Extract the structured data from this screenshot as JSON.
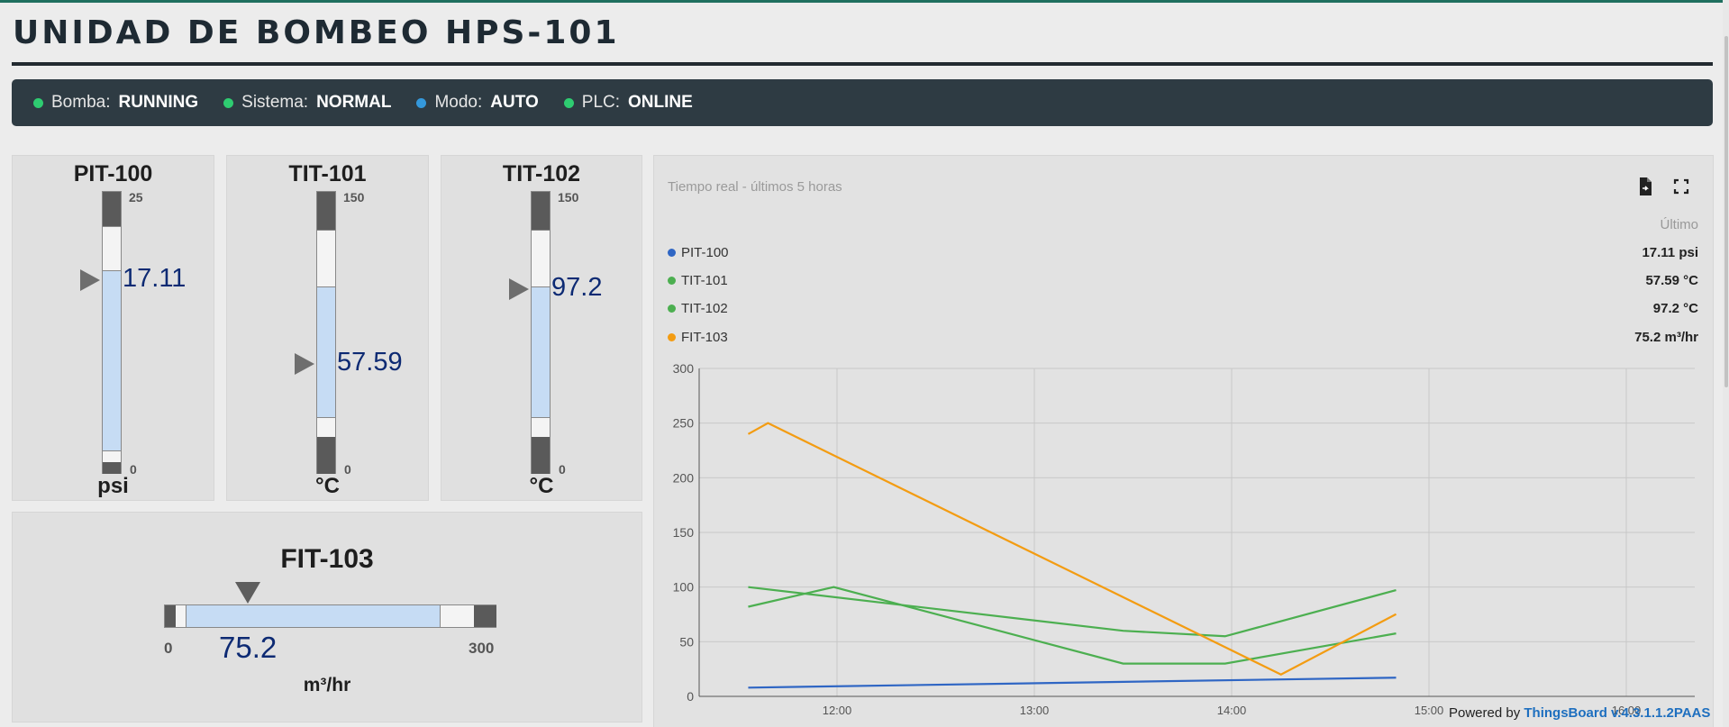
{
  "title": "UNIDAD DE BOMBEO HPS-101",
  "status": [
    {
      "key": "Bomba:",
      "value": "RUNNING",
      "color": "#2ecc71"
    },
    {
      "key": "Sistema:",
      "value": "NORMAL",
      "color": "#2ecc71"
    },
    {
      "key": "Modo:",
      "value": "AUTO",
      "color": "#3498db"
    },
    {
      "key": "PLC:",
      "value": "ONLINE",
      "color": "#2ecc71"
    }
  ],
  "gauges": {
    "pit100": {
      "name": "PIT-100",
      "unit": "psi",
      "value": "17.11",
      "max": "25",
      "min": "0"
    },
    "tit101": {
      "name": "TIT-101",
      "unit": "°C",
      "value": "57.59",
      "max": "150",
      "min": "0"
    },
    "tit102": {
      "name": "TIT-102",
      "unit": "°C",
      "value": "97.2",
      "max": "150",
      "min": "0"
    },
    "fit103": {
      "name": "FIT-103",
      "unit": "m³/hr",
      "value": "75.2",
      "max": "300",
      "min": "0"
    }
  },
  "chart": {
    "subtitle": "Tiempo real - últimos 5 horas",
    "legend_header": "Último",
    "legend": [
      {
        "name": "PIT-100",
        "value": "17.11 psi",
        "color": "#2f66c4"
      },
      {
        "name": "TIT-101",
        "value": "57.59 °C",
        "color": "#4caf50"
      },
      {
        "name": "TIT-102",
        "value": "97.2 °C",
        "color": "#4caf50"
      },
      {
        "name": "FIT-103",
        "value": "75.2 m³/hr",
        "color": "#f39c12"
      }
    ]
  },
  "chart_data": {
    "type": "line",
    "ylim": [
      0,
      300
    ],
    "yticks": [
      "0",
      "50",
      "100",
      "150",
      "200",
      "250",
      "300"
    ],
    "xticks": [
      "12:00",
      "13:00",
      "14:00",
      "15:00",
      "16:00"
    ],
    "grid": true,
    "series": [
      {
        "name": "PIT-100",
        "color": "#2f66c4",
        "x": [
          "11:33",
          "14:50"
        ],
        "y": [
          8,
          17.11
        ]
      },
      {
        "name": "TIT-101",
        "color": "#4caf50",
        "x": [
          "11:33",
          "11:59",
          "13:27",
          "13:58",
          "14:50"
        ],
        "y": [
          82,
          100,
          30,
          30,
          57.59
        ]
      },
      {
        "name": "TIT-102",
        "color": "#4caf50",
        "x": [
          "11:33",
          "13:27",
          "13:58",
          "14:50"
        ],
        "y": [
          100,
          60,
          55,
          97.2
        ]
      },
      {
        "name": "FIT-103",
        "color": "#f39c12",
        "x": [
          "11:33",
          "11:39",
          "14:15",
          "14:50"
        ],
        "y": [
          240,
          250,
          20,
          75.2
        ]
      }
    ]
  },
  "footer": {
    "prefix": "Powered by",
    "brand": "ThingsBoard v.4.3.1.1.2PAAS"
  },
  "icons": {
    "export": "export-file-icon",
    "fullscreen": "fullscreen-icon"
  }
}
